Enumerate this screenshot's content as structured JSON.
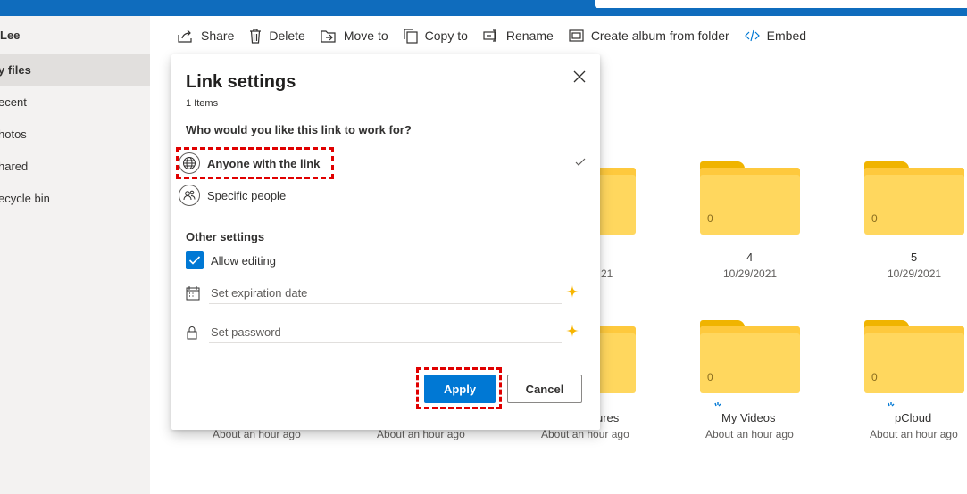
{
  "sidebar": {
    "user": "Lee",
    "items": [
      {
        "label": "y files",
        "selected": true
      },
      {
        "label": "ecent"
      },
      {
        "label": "hotos"
      },
      {
        "label": "hared"
      },
      {
        "label": "ecycle bin"
      }
    ]
  },
  "toolbar": {
    "items": [
      {
        "label": "Share",
        "icon": "share-icon"
      },
      {
        "label": "Delete",
        "icon": "trash-icon"
      },
      {
        "label": "Move to",
        "icon": "move-to-icon"
      },
      {
        "label": "Copy to",
        "icon": "copy-icon"
      },
      {
        "label": "Rename",
        "icon": "rename-icon"
      },
      {
        "label": "Create album from folder",
        "icon": "album-icon"
      },
      {
        "label": "Embed",
        "icon": "embed-icon"
      }
    ]
  },
  "folders": [
    {
      "name": "",
      "date": "21",
      "count": ""
    },
    {
      "name": "4",
      "date": "10/29/2021",
      "count": "0"
    },
    {
      "name": "5",
      "date": "10/29/2021",
      "count": "0"
    },
    {
      "name": "",
      "date": "About an hour ago",
      "count": ""
    },
    {
      "name": "",
      "date": "About an hour ago",
      "count": ""
    },
    {
      "name": "ures",
      "date": "About an hour ago",
      "count": ""
    },
    {
      "name": "My Videos",
      "date": "About an hour ago",
      "count": "0"
    },
    {
      "name": "pCloud",
      "date": "About an hour ago",
      "count": "0"
    }
  ],
  "dialog": {
    "title": "Link settings",
    "items_count": "1 Items",
    "question": "Who would you like this link to work for?",
    "options": [
      {
        "label": "Anyone with the link",
        "icon": "globe-icon",
        "selected": true
      },
      {
        "label": "Specific people",
        "icon": "people-icon",
        "selected": false
      }
    ],
    "other_settings_label": "Other settings",
    "allow_editing_label": "Allow editing",
    "allow_editing_checked": true,
    "expiration_placeholder": "Set expiration date",
    "password_placeholder": "Set password",
    "apply_label": "Apply",
    "cancel_label": "Cancel"
  },
  "colors": {
    "accent": "#0078d4",
    "highlight": "#e00000",
    "folder": "#ffd75e",
    "premium_spark": "#f7b500"
  }
}
